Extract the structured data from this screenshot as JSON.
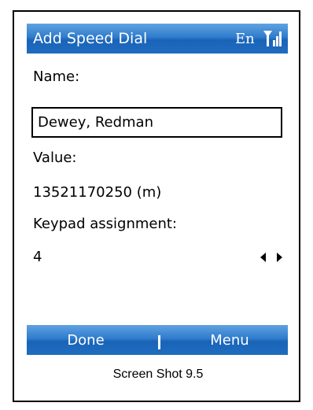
{
  "titlebar": {
    "title": "Add Speed Dial",
    "language": "En",
    "signal_icon": "signal-strength-icon"
  },
  "form": {
    "name_label": "Name:",
    "name_value": "Dewey, Redman",
    "value_label": "Value:",
    "value_text": "13521170250 (m)",
    "keypad_label": "Keypad assignment:",
    "keypad_value": "4",
    "keypad_arrows_icon": "left-right-arrows-icon"
  },
  "softkeys": {
    "left": "Done",
    "right": "Menu"
  },
  "caption": "Screen Shot 9.5"
}
